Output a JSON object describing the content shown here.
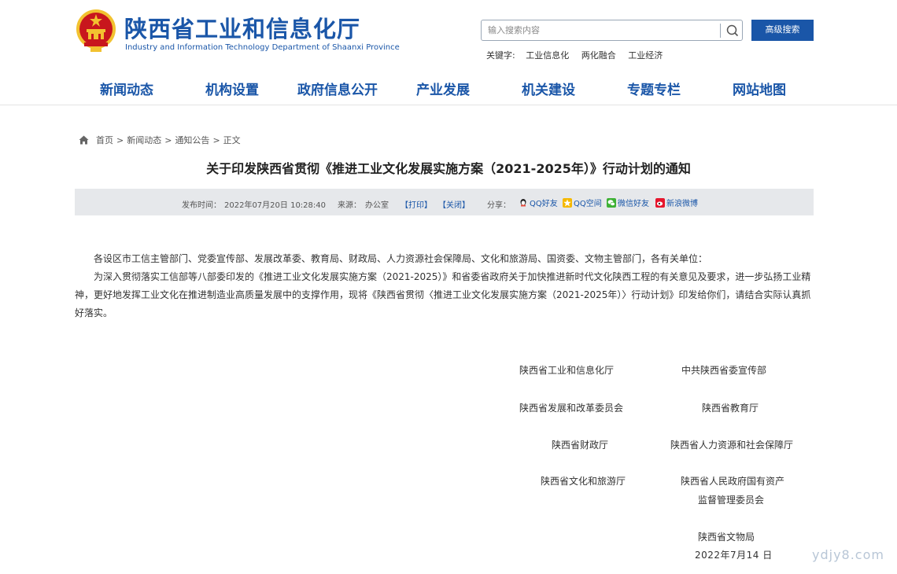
{
  "site": {
    "title": "陕西省工业和信息化厅",
    "subtitle": "Industry and Information Technology Department of Shaanxi Province"
  },
  "search": {
    "placeholder": "输入搜索内容",
    "advanced_label": "高级搜索"
  },
  "keywords": {
    "label": "关键字:",
    "items": [
      "工业信息化",
      "两化融合",
      "工业经济"
    ]
  },
  "nav": {
    "items": [
      "新闻动态",
      "机构设置",
      "政府信息公开",
      "产业发展",
      "机关建设",
      "专题专栏",
      "网站地图"
    ]
  },
  "breadcrumb": {
    "items": [
      "首页",
      "新闻动态",
      "通知公告",
      "正文"
    ],
    "separator": ">"
  },
  "article": {
    "title": "关于印发陕西省贯彻《推进工业文化发展实施方案（2021-2025年）》行动计划的通知",
    "meta": {
      "publish_label": "发布时间：",
      "publish_time": "2022年07月20日 10:28:40",
      "source_label": "来源：",
      "source": "办公室",
      "print": "【打印】",
      "close": "【关闭】",
      "share_label": "分享：",
      "share": [
        "QQ好友",
        "QQ空间",
        "微信好友",
        "新浪微博"
      ]
    },
    "paragraphs": [
      "各设区市工信主管部门、党委宣传部、发展改革委、教育局、财政局、人力资源社会保障局、文化和旅游局、国资委、文物主管部门，各有关单位：",
      "为深入贯彻落实工信部等八部委印发的《推进工业文化发展实施方案（2021-2025）》和省委省政府关于加快推进新时代文化陕西工程的有关意见及要求，进一步弘扬工业精神，更好地发挥工业文化在推进制造业高质量发展中的支撑作用，现将《陕西省贯彻〈推进工业文化发展实施方案（2021-2025年）〉行动计划》印发给你们，请结合实际认真抓好落实。"
    ],
    "signatories": {
      "left": [
        "陕西省工业和信息化厅",
        "陕西省发展和改革委员会",
        "陕西省财政厅",
        "陕西省文化和旅游厅"
      ],
      "right": [
        "中共陕西省委宣传部",
        "陕西省教育厅",
        "陕西省人力资源和社会保障厅",
        "陕西省人民政府国有资产",
        "监督管理委员会",
        "陕西省文物局"
      ],
      "date": "2022年7月14 日"
    }
  },
  "watermark": "ydjy8.com",
  "colors": {
    "brand_blue": "#1a56a8",
    "meta_bar_bg": "#e6e8eb",
    "emblem_red": "#c8161d",
    "emblem_gold": "#f2c230"
  }
}
